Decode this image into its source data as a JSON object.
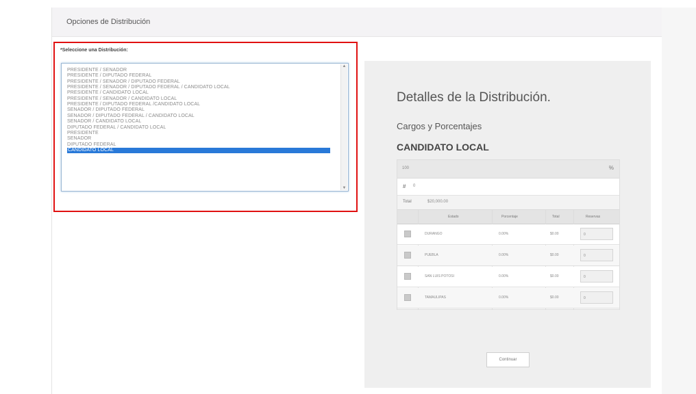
{
  "panel": {
    "title": "Opciones de Distribución"
  },
  "select": {
    "label": "*Seleccione una Distribución:",
    "options": [
      "PRESIDENTE / SENADOR",
      "PRESIDENTE / DIPUTADO FEDERAL",
      "PRESIDENTE / SENADOR / DIPUTADO FEDERAL",
      "PRESIDENTE / SENADOR / DIPUTADO FEDERAL / CANDIDATO LOCAL",
      "PRESIDENTE / CANDIDATO LOCAL",
      "PRESIDENTE / SENADOR / CANDIDATO LOCAL",
      "PRESIDENTE / DIPUTADO FEDERAL /CANDIDATO LOCAL",
      "SENADOR / DIPUTADO FEDERAL",
      "SENADOR / DIPUTADO FEDERAL / CANDIDATO LOCAL",
      "SENADOR / CANDIDATO LOCAL",
      "DIPUTADO FEDERAL / CANDIDATO LOCAL",
      "PRESIDENTE",
      "SENADOR",
      "DIPUTADO FEDERAL",
      "CANDIDATO LOCAL"
    ],
    "selected_index": 14,
    "scroll_up": "▲",
    "scroll_down": "▼"
  },
  "details": {
    "title": "Detalles de la Distribución.",
    "subtitle": "Cargos y Porcentajes",
    "candidate": "CANDIDATO LOCAL",
    "header_left": "100",
    "header_right": "%",
    "input_sign": "#",
    "input_value": "0",
    "total_label": "Total",
    "total_value": "$20,000.00",
    "columns": [
      "Estado",
      "Porcentaje",
      "Total",
      "Reservas"
    ],
    "rows": [
      {
        "estado": "DURANGO",
        "porcentaje": "0.00%",
        "total": "$0.00",
        "reserva": "0"
      },
      {
        "estado": "PUEBLA",
        "porcentaje": "0.00%",
        "total": "$0.00",
        "reserva": "0"
      },
      {
        "estado": "SAN LUIS POTOSI",
        "porcentaje": "0.00%",
        "total": "$0.00",
        "reserva": "0"
      },
      {
        "estado": "TAMAULIPAS",
        "porcentaje": "0.00%",
        "total": "$0.00",
        "reserva": "0"
      }
    ],
    "continue_label": "Continuar"
  }
}
